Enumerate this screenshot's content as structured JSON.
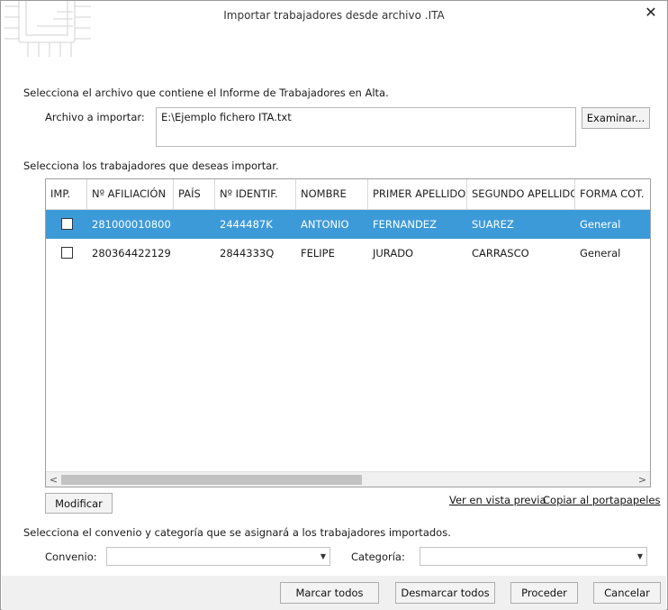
{
  "window": {
    "title": "Importar trabajadores desde archivo .ITA",
    "close_glyph": "✕"
  },
  "file_section": {
    "instruction": "Selecciona el archivo que contiene el Informe de Trabajadores en Alta.",
    "label": "Archivo a importar:",
    "value": "E:\\Ejemplo fichero ITA.txt",
    "browse_label": "Examinar..."
  },
  "workers_section": {
    "instruction": "Selecciona los trabajadores que deseas importar.",
    "columns": [
      "IMP.",
      "Nº AFILIACIÓN",
      "PAÍS",
      "Nº IDENTIF.",
      "NOMBRE",
      "PRIMER APELLIDO",
      "SEGUNDO APELLIDO",
      "FORMA COT."
    ],
    "rows": [
      {
        "checked": false,
        "selected": true,
        "afiliacion": "281000010800",
        "pais": "",
        "identif": "2444487K",
        "nombre": "ANTONIO",
        "primer_apellido": "FERNANDEZ",
        "segundo_apellido": "SUAREZ",
        "forma_cot": "General"
      },
      {
        "checked": false,
        "selected": false,
        "afiliacion": "280364422129",
        "pais": "",
        "identif": "2844333Q",
        "nombre": "FELIPE",
        "primer_apellido": "JURADO",
        "segundo_apellido": "CARRASCO",
        "forma_cot": "General"
      }
    ],
    "scroll_left_glyph": "<",
    "scroll_right_glyph": ">",
    "modify_label": "Modificar",
    "preview_link": "Ver en vista previa",
    "copy_link": "Copiar al portapapeles"
  },
  "agreement_section": {
    "instruction": "Selecciona el convenio y categoría que se asignará a los trabajadores importados.",
    "convenio_label": "Convenio:",
    "convenio_value": "",
    "categoria_label": "Categoría:",
    "categoria_value": "",
    "dropdown_glyph": "▼"
  },
  "footer": {
    "mark_all": "Marcar todos",
    "unmark_all": "Desmarcar todos",
    "proceed": "Proceder",
    "cancel": "Cancelar"
  }
}
